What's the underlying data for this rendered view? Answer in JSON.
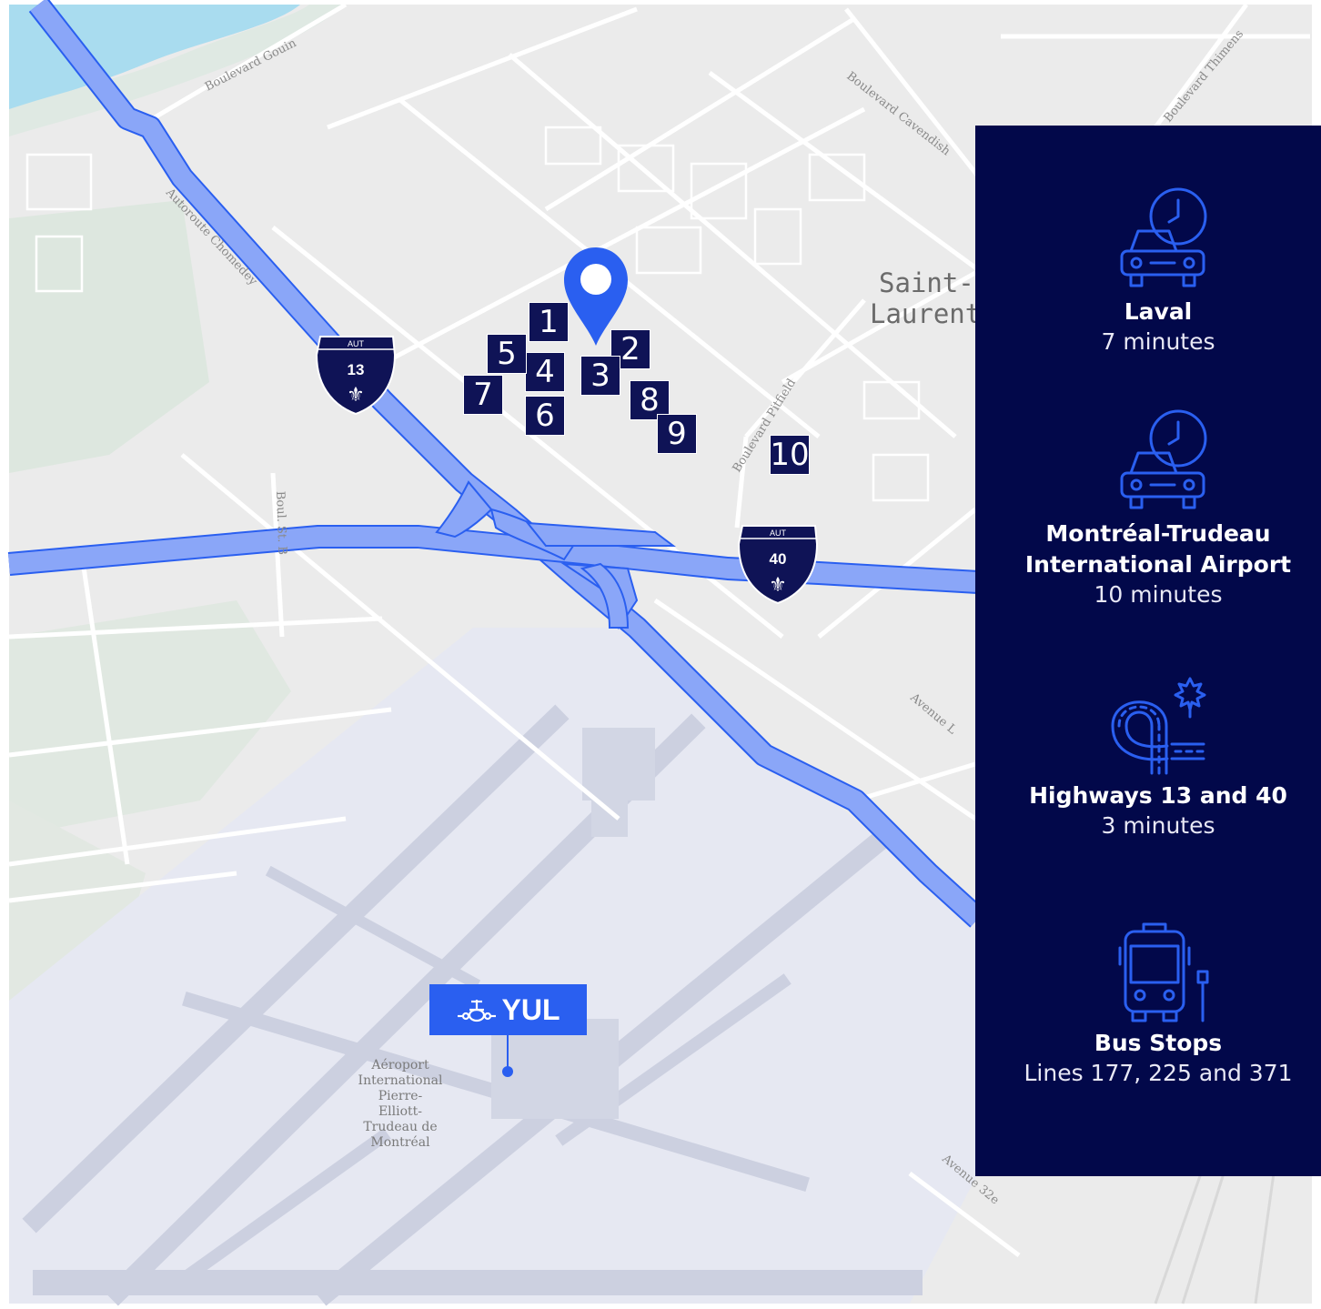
{
  "map": {
    "place_label_line1": "Saint-",
    "place_label_line2": "Laurent",
    "road_labels": {
      "r1": "Boulevard Gouin",
      "r2": "Boulevard Cavendish",
      "r3": "Autoroute Chomedey",
      "r4": "Boulevard Pitfield",
      "r5": "Boulevard Thimens",
      "r6": "Avenue 32e",
      "r7": "Avenue L",
      "r8": "Boul. St. B"
    },
    "highway_13": {
      "top": "AUT",
      "number": "13"
    },
    "highway_40": {
      "top": "AUT",
      "number": "40"
    },
    "lots": [
      "1",
      "2",
      "3",
      "4",
      "5",
      "6",
      "7",
      "8",
      "9",
      "10"
    ],
    "airport": {
      "code": "YUL",
      "label": "Aéroport\nInternational\nPierre-\nElliott-\nTrudeau de\nMontréal"
    },
    "colors": {
      "highway": "#8aa6f8",
      "highway_stroke": "#2a5ff0",
      "marker": "#2a5ff0",
      "lot": "#0f1356",
      "panel": "#02084a"
    }
  },
  "panel": {
    "items": [
      {
        "icon": "car-clock-icon",
        "title": "Laval",
        "detail": "7 minutes"
      },
      {
        "icon": "car-clock-icon",
        "title_line1": "Montréal-Trudeau",
        "title_line2": "International Airport",
        "detail": "10 minutes"
      },
      {
        "icon": "highway-interchange-icon",
        "title": "Highways 13 and 40",
        "detail": "3 minutes"
      },
      {
        "icon": "bus-stop-icon",
        "title": "Bus Stops",
        "detail": "Lines 177, 225 and 371"
      }
    ]
  }
}
